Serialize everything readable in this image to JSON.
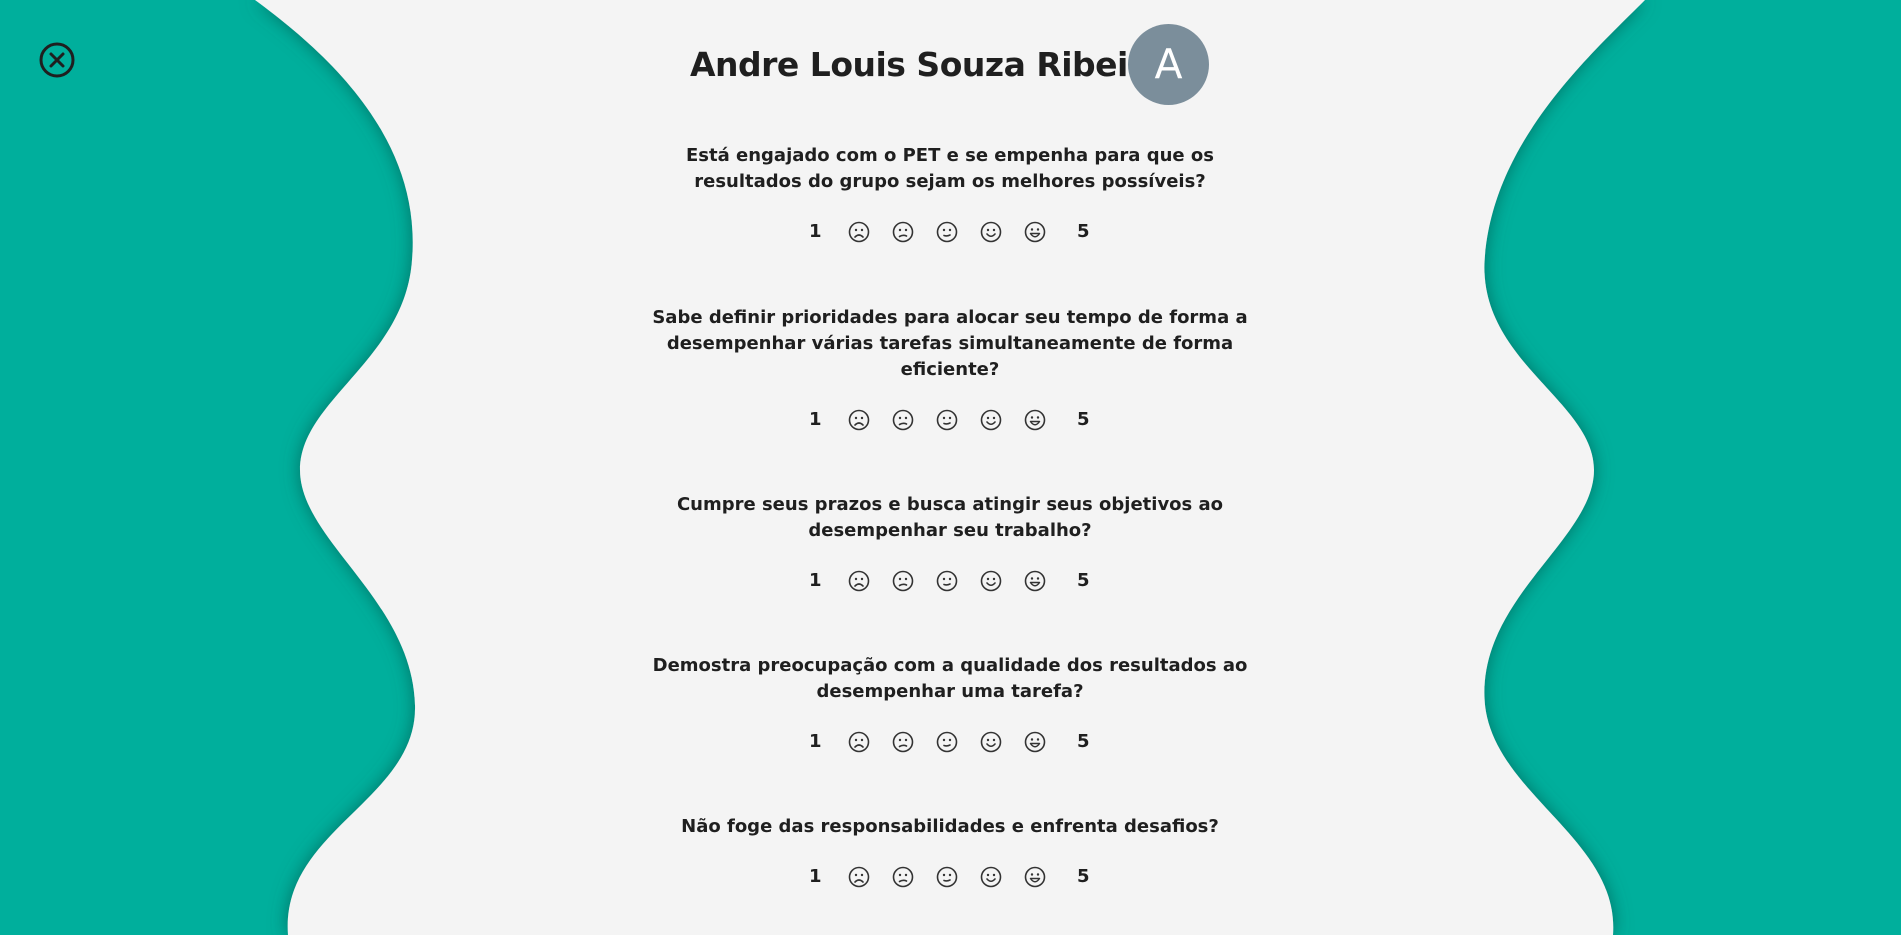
{
  "theme": {
    "accent": "#00af9c",
    "panel": "#f4f4f4",
    "text": "#1f1f1f",
    "avatar_bg": "#7b8e9b"
  },
  "header": {
    "name": "Andre Louis Souza Ribeiro",
    "avatar_initial": "A",
    "close_icon": "close-circle-icon"
  },
  "rating_icons": [
    "very-sad-face-icon",
    "sad-face-icon",
    "neutral-face-icon",
    "smile-face-icon",
    "grin-face-icon"
  ],
  "questions": [
    {
      "text": "Está engajado com o PET e se empenha para que os resultados do grupo sejam os melhores possíveis?",
      "min_label": "1",
      "max_label": "5"
    },
    {
      "text": "Sabe definir prioridades para alocar seu tempo de forma a desempenhar várias tarefas simultaneamente de forma eficiente?",
      "min_label": "1",
      "max_label": "5"
    },
    {
      "text": "Cumpre seus prazos e busca atingir seus objetivos ao desempenhar seu trabalho?",
      "min_label": "1",
      "max_label": "5"
    },
    {
      "text": "Demostra preocupação com a qualidade dos resultados ao desempenhar uma tarefa?",
      "min_label": "1",
      "max_label": "5"
    },
    {
      "text": "Não foge das responsabilidades e enfrenta desafios?",
      "min_label": "1",
      "max_label": "5"
    }
  ]
}
